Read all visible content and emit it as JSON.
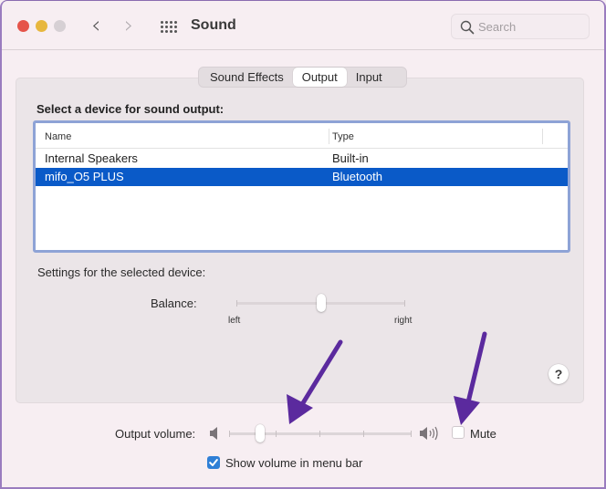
{
  "window": {
    "title": "Sound",
    "traffic_lights": [
      "close",
      "minimize",
      "zoom"
    ],
    "nav": {
      "back_icon": "chevron-left-icon",
      "forward_icon": "chevron-right-icon",
      "grid_icon": "show-all-grid-icon"
    },
    "search": {
      "placeholder": "Search",
      "value": ""
    }
  },
  "tabs": [
    {
      "label": "Sound Effects",
      "active": false
    },
    {
      "label": "Output",
      "active": true
    },
    {
      "label": "Input",
      "active": false
    }
  ],
  "device_section": {
    "title": "Select a device for sound output:",
    "columns": [
      "Name",
      "Type"
    ],
    "rows": [
      {
        "name": "Internal Speakers",
        "type": "Built-in",
        "selected": false
      },
      {
        "name": "mifo_O5 PLUS",
        "type": "Bluetooth",
        "selected": true
      }
    ]
  },
  "settings": {
    "label": "Settings for the selected device:",
    "balance": {
      "label": "Balance:",
      "left_label": "left",
      "right_label": "right",
      "value": 0.5
    }
  },
  "help_label": "?",
  "output_volume": {
    "label": "Output volume:",
    "value": 0.17,
    "mute_label": "Mute",
    "muted": false
  },
  "show_volume": {
    "label": "Show volume in menu bar",
    "checked": true
  },
  "colors": {
    "selection": "#0a5ac8",
    "table_focus_ring": "#8ea3d6",
    "checkbox_accent": "#2f7fd6",
    "annotation_arrow": "#5b2a9e"
  },
  "annotations": [
    {
      "type": "arrow",
      "points_to": "output-volume-slider"
    },
    {
      "type": "arrow",
      "points_to": "mute-checkbox"
    }
  ]
}
